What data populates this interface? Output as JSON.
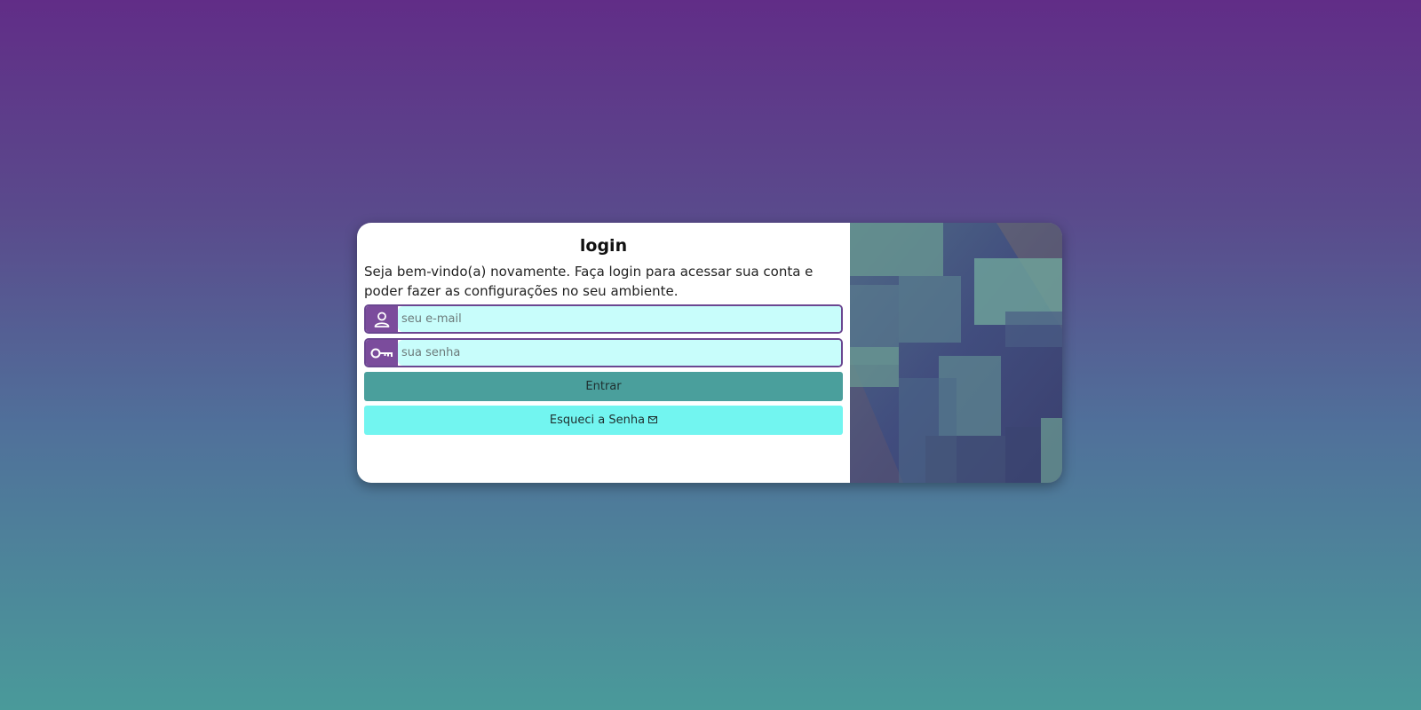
{
  "login": {
    "title": "login",
    "intro": "Seja bem-vindo(a) novamente. Faça login para acessar sua conta e poder fazer as configurações no seu ambiente.",
    "email": {
      "placeholder": "seu e-mail",
      "icon": "user-icon"
    },
    "password": {
      "placeholder": "sua senha",
      "icon": "key-icon"
    },
    "submit_label": "Entrar",
    "forgot_label": "Esqueci a Senha",
    "forgot_icon": "envelope-icon"
  },
  "colors": {
    "accent_purple": "#7b4c9c",
    "input_bg": "#c8fdfb",
    "submit_bg": "#4a9f9c",
    "forgot_bg": "#72f5f0"
  }
}
